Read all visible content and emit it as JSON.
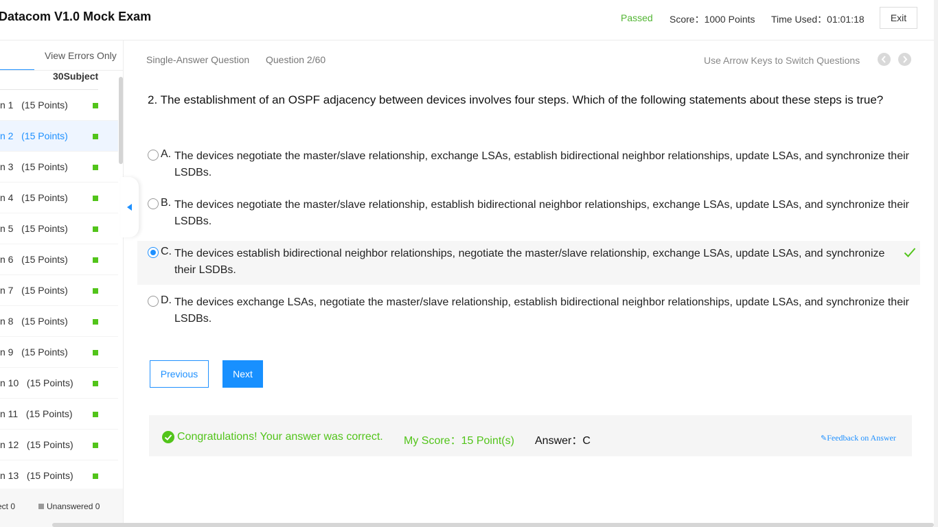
{
  "header": {
    "title": "Datacom V1.0 Mock Exam",
    "status": "Passed",
    "score": "Score：1000 Points",
    "time_used": "Time Used：01:01:18",
    "exit_label": "Exit"
  },
  "sidebar": {
    "view_errors_label": "View Errors Only",
    "subject_count": "30Subject",
    "items": [
      {
        "label": "n 1   (15 Points)"
      },
      {
        "label": "n 2   (15 Points)"
      },
      {
        "label": "n 3   (15 Points)"
      },
      {
        "label": "n 4   (15 Points)"
      },
      {
        "label": "n 5   (15 Points)"
      },
      {
        "label": "n 6   (15 Points)"
      },
      {
        "label": "n 7   (15 Points)"
      },
      {
        "label": "n 8   (15 Points)"
      },
      {
        "label": "n 9   (15 Points)"
      },
      {
        "label": "n 10   (15 Points)"
      },
      {
        "label": "n 11   (15 Points)"
      },
      {
        "label": "n 12   (15 Points)"
      },
      {
        "label": "n 13   (15 Points)"
      }
    ],
    "legend_correct": "ect 0",
    "legend_unanswered": "Unanswered 0"
  },
  "question": {
    "type": "Single-Answer Question",
    "number": "Question 2/60",
    "arrow_hint": "Use Arrow Keys to Switch Questions",
    "text": "2. The establishment of an OSPF adjacency between devices involves four steps. Which of the following statements about these steps is true?",
    "options": [
      {
        "letter": "A.",
        "text": "The devices negotiate the master/slave relationship, exchange LSAs, establish bidirectional neighbor relationships, update LSAs, and synchronize their LSDBs."
      },
      {
        "letter": "B.",
        "text": "The devices negotiate the master/slave relationship, establish bidirectional neighbor relationships, exchange LSAs, update LSAs, and synchronize their LSDBs."
      },
      {
        "letter": "C.",
        "text": "The devices establish bidirectional neighbor relationships, negotiate the master/slave relationship, exchange LSAs, update LSAs, and synchronize their LSDBs."
      },
      {
        "letter": "D.",
        "text": "The devices exchange LSAs, negotiate the master/slave relationship, establish bidirectional neighbor relationships, update LSAs, and synchronize their LSDBs."
      }
    ]
  },
  "buttons": {
    "previous": "Previous",
    "next": "Next"
  },
  "result": {
    "message": "Congratulations! Your answer was correct.",
    "my_score": "My Score：15 Point(s)",
    "answer": "Answer：C",
    "feedback": "Feedback on Answer"
  },
  "colors": {
    "accent": "#1890ff",
    "success": "#52c41a",
    "passed": "#52b533"
  }
}
